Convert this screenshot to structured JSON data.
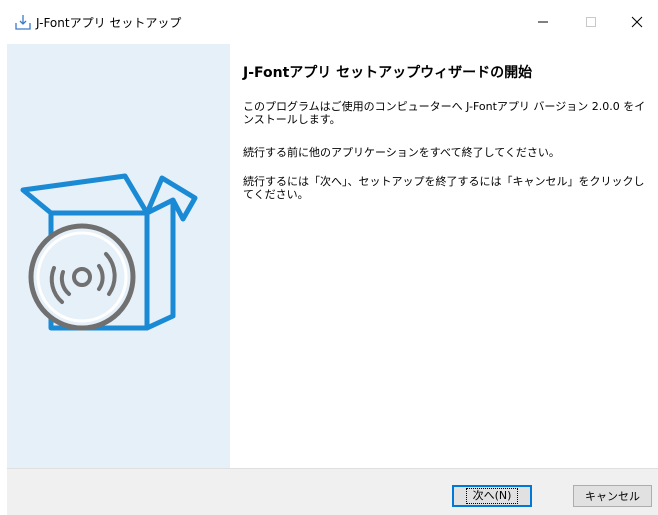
{
  "window": {
    "title": "J-Fontアプリ セットアップ"
  },
  "content": {
    "heading": "J-Fontアプリ セットアップウィザードの開始",
    "paragraphs": [
      "このプログラムはご使用のコンピューターへ J-Fontアプリ バージョン 2.0.0 をインストールします。",
      "続行する前に他のアプリケーションをすべて終了してください。",
      "続行するには「次へ」、セットアップを終了するには「キャンセル」をクリックしてください。"
    ]
  },
  "buttons": {
    "next": "次へ(N)",
    "cancel": "キャンセル"
  },
  "icons": {
    "app": "install-icon",
    "banner": "box-with-disc-icon"
  },
  "colors": {
    "banner_bg": "#e6f0f9",
    "accent": "#1a8ad4",
    "focus": "#0078d7"
  }
}
